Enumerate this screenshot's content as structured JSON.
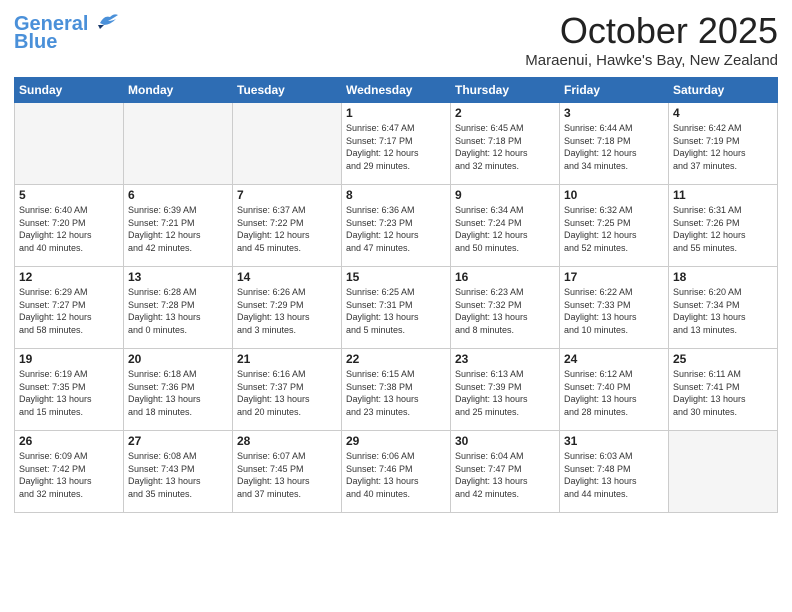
{
  "header": {
    "logo_line1": "General",
    "logo_line2": "Blue",
    "month": "October 2025",
    "location": "Maraenui, Hawke's Bay, New Zealand"
  },
  "days_of_week": [
    "Sunday",
    "Monday",
    "Tuesday",
    "Wednesday",
    "Thursday",
    "Friday",
    "Saturday"
  ],
  "weeks": [
    [
      {
        "day": "",
        "empty": true
      },
      {
        "day": "",
        "empty": true
      },
      {
        "day": "",
        "empty": true
      },
      {
        "day": "1",
        "lines": [
          "Sunrise: 6:47 AM",
          "Sunset: 7:17 PM",
          "Daylight: 12 hours",
          "and 29 minutes."
        ]
      },
      {
        "day": "2",
        "lines": [
          "Sunrise: 6:45 AM",
          "Sunset: 7:18 PM",
          "Daylight: 12 hours",
          "and 32 minutes."
        ]
      },
      {
        "day": "3",
        "lines": [
          "Sunrise: 6:44 AM",
          "Sunset: 7:18 PM",
          "Daylight: 12 hours",
          "and 34 minutes."
        ]
      },
      {
        "day": "4",
        "lines": [
          "Sunrise: 6:42 AM",
          "Sunset: 7:19 PM",
          "Daylight: 12 hours",
          "and 37 minutes."
        ]
      }
    ],
    [
      {
        "day": "5",
        "lines": [
          "Sunrise: 6:40 AM",
          "Sunset: 7:20 PM",
          "Daylight: 12 hours",
          "and 40 minutes."
        ]
      },
      {
        "day": "6",
        "lines": [
          "Sunrise: 6:39 AM",
          "Sunset: 7:21 PM",
          "Daylight: 12 hours",
          "and 42 minutes."
        ]
      },
      {
        "day": "7",
        "lines": [
          "Sunrise: 6:37 AM",
          "Sunset: 7:22 PM",
          "Daylight: 12 hours",
          "and 45 minutes."
        ]
      },
      {
        "day": "8",
        "lines": [
          "Sunrise: 6:36 AM",
          "Sunset: 7:23 PM",
          "Daylight: 12 hours",
          "and 47 minutes."
        ]
      },
      {
        "day": "9",
        "lines": [
          "Sunrise: 6:34 AM",
          "Sunset: 7:24 PM",
          "Daylight: 12 hours",
          "and 50 minutes."
        ]
      },
      {
        "day": "10",
        "lines": [
          "Sunrise: 6:32 AM",
          "Sunset: 7:25 PM",
          "Daylight: 12 hours",
          "and 52 minutes."
        ]
      },
      {
        "day": "11",
        "lines": [
          "Sunrise: 6:31 AM",
          "Sunset: 7:26 PM",
          "Daylight: 12 hours",
          "and 55 minutes."
        ]
      }
    ],
    [
      {
        "day": "12",
        "lines": [
          "Sunrise: 6:29 AM",
          "Sunset: 7:27 PM",
          "Daylight: 12 hours",
          "and 58 minutes."
        ]
      },
      {
        "day": "13",
        "lines": [
          "Sunrise: 6:28 AM",
          "Sunset: 7:28 PM",
          "Daylight: 13 hours",
          "and 0 minutes."
        ]
      },
      {
        "day": "14",
        "lines": [
          "Sunrise: 6:26 AM",
          "Sunset: 7:29 PM",
          "Daylight: 13 hours",
          "and 3 minutes."
        ]
      },
      {
        "day": "15",
        "lines": [
          "Sunrise: 6:25 AM",
          "Sunset: 7:31 PM",
          "Daylight: 13 hours",
          "and 5 minutes."
        ]
      },
      {
        "day": "16",
        "lines": [
          "Sunrise: 6:23 AM",
          "Sunset: 7:32 PM",
          "Daylight: 13 hours",
          "and 8 minutes."
        ]
      },
      {
        "day": "17",
        "lines": [
          "Sunrise: 6:22 AM",
          "Sunset: 7:33 PM",
          "Daylight: 13 hours",
          "and 10 minutes."
        ]
      },
      {
        "day": "18",
        "lines": [
          "Sunrise: 6:20 AM",
          "Sunset: 7:34 PM",
          "Daylight: 13 hours",
          "and 13 minutes."
        ]
      }
    ],
    [
      {
        "day": "19",
        "lines": [
          "Sunrise: 6:19 AM",
          "Sunset: 7:35 PM",
          "Daylight: 13 hours",
          "and 15 minutes."
        ]
      },
      {
        "day": "20",
        "lines": [
          "Sunrise: 6:18 AM",
          "Sunset: 7:36 PM",
          "Daylight: 13 hours",
          "and 18 minutes."
        ]
      },
      {
        "day": "21",
        "lines": [
          "Sunrise: 6:16 AM",
          "Sunset: 7:37 PM",
          "Daylight: 13 hours",
          "and 20 minutes."
        ]
      },
      {
        "day": "22",
        "lines": [
          "Sunrise: 6:15 AM",
          "Sunset: 7:38 PM",
          "Daylight: 13 hours",
          "and 23 minutes."
        ]
      },
      {
        "day": "23",
        "lines": [
          "Sunrise: 6:13 AM",
          "Sunset: 7:39 PM",
          "Daylight: 13 hours",
          "and 25 minutes."
        ]
      },
      {
        "day": "24",
        "lines": [
          "Sunrise: 6:12 AM",
          "Sunset: 7:40 PM",
          "Daylight: 13 hours",
          "and 28 minutes."
        ]
      },
      {
        "day": "25",
        "lines": [
          "Sunrise: 6:11 AM",
          "Sunset: 7:41 PM",
          "Daylight: 13 hours",
          "and 30 minutes."
        ]
      }
    ],
    [
      {
        "day": "26",
        "lines": [
          "Sunrise: 6:09 AM",
          "Sunset: 7:42 PM",
          "Daylight: 13 hours",
          "and 32 minutes."
        ]
      },
      {
        "day": "27",
        "lines": [
          "Sunrise: 6:08 AM",
          "Sunset: 7:43 PM",
          "Daylight: 13 hours",
          "and 35 minutes."
        ]
      },
      {
        "day": "28",
        "lines": [
          "Sunrise: 6:07 AM",
          "Sunset: 7:45 PM",
          "Daylight: 13 hours",
          "and 37 minutes."
        ]
      },
      {
        "day": "29",
        "lines": [
          "Sunrise: 6:06 AM",
          "Sunset: 7:46 PM",
          "Daylight: 13 hours",
          "and 40 minutes."
        ]
      },
      {
        "day": "30",
        "lines": [
          "Sunrise: 6:04 AM",
          "Sunset: 7:47 PM",
          "Daylight: 13 hours",
          "and 42 minutes."
        ]
      },
      {
        "day": "31",
        "lines": [
          "Sunrise: 6:03 AM",
          "Sunset: 7:48 PM",
          "Daylight: 13 hours",
          "and 44 minutes."
        ]
      },
      {
        "day": "",
        "empty": true
      }
    ]
  ]
}
